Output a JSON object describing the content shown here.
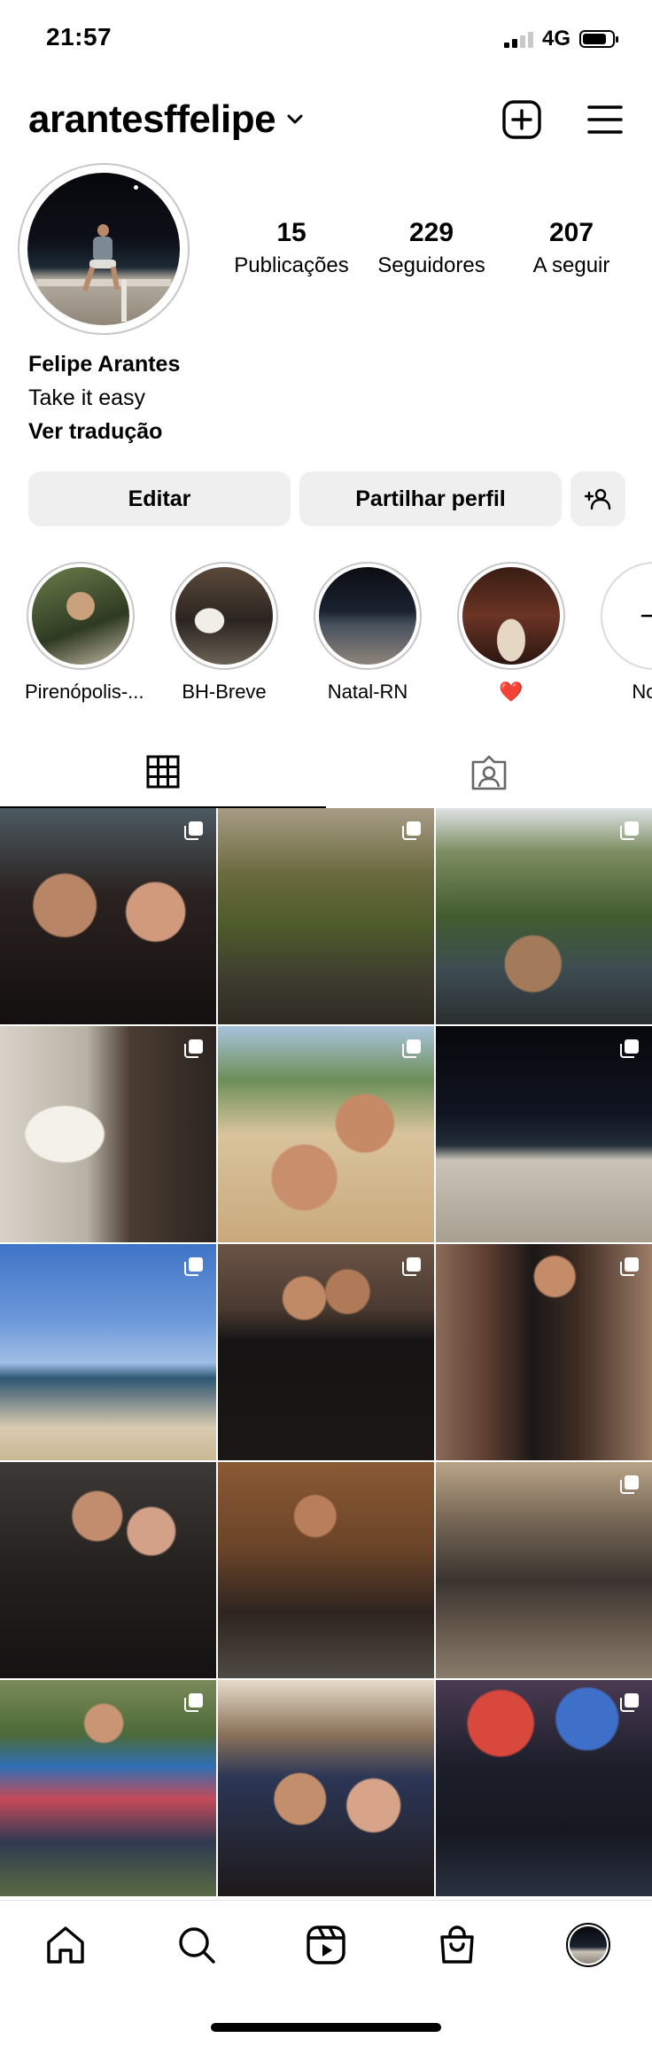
{
  "status_bar": {
    "time": "21:57",
    "network": "4G"
  },
  "header": {
    "username": "arantesffelipe",
    "icons": [
      "chevron-down-icon",
      "new-post-icon",
      "menu-icon"
    ]
  },
  "stats": [
    {
      "value": "15",
      "label": "Publicações"
    },
    {
      "value": "229",
      "label": "Seguidores"
    },
    {
      "value": "207",
      "label": "A seguir"
    }
  ],
  "bio": {
    "name": "Felipe Arantes",
    "text": "Take it easy",
    "translate": "Ver tradução"
  },
  "actions": {
    "edit": "Editar",
    "share": "Partilhar perfil",
    "add_person_icon": "person-add-icon"
  },
  "highlights": [
    {
      "label": "Pirenópolis-..."
    },
    {
      "label": "BH-Breve"
    },
    {
      "label": "Natal-RN"
    },
    {
      "label": "❤️"
    },
    {
      "label": "Novo"
    }
  ],
  "tabs": [
    {
      "icon": "grid-icon",
      "active": true
    },
    {
      "icon": "tagged-icon",
      "active": false
    }
  ],
  "posts": [
    {
      "multi": true
    },
    {
      "multi": true
    },
    {
      "multi": true
    },
    {
      "multi": true
    },
    {
      "multi": true
    },
    {
      "multi": true
    },
    {
      "multi": true
    },
    {
      "multi": true
    },
    {
      "multi": true
    },
    {
      "multi": false
    },
    {
      "multi": false
    },
    {
      "multi": true
    },
    {
      "multi": true
    },
    {
      "multi": false
    },
    {
      "multi": true
    }
  ],
  "bottom_nav": [
    "home-icon",
    "search-icon",
    "reels-icon",
    "shop-icon",
    "profile-avatar"
  ]
}
